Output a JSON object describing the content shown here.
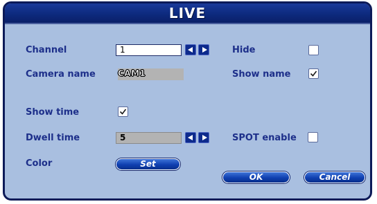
{
  "window": {
    "title": "LIVE"
  },
  "channel": {
    "label": "Channel",
    "value": "1"
  },
  "hide": {
    "label": "Hide",
    "checked": false
  },
  "camera_name": {
    "label": "Camera name",
    "value": "CAM1"
  },
  "show_name": {
    "label": "Show name",
    "checked": true
  },
  "show_time": {
    "label": "Show time",
    "checked": true
  },
  "dwell_time": {
    "label": "Dwell time",
    "value": "5"
  },
  "spot_enable": {
    "label": "SPOT enable",
    "checked": false
  },
  "color": {
    "label": "Color",
    "button_label": "Set"
  },
  "buttons": {
    "ok": "OK",
    "cancel": "Cancel"
  },
  "colors": {
    "panel_bg": "#a9bfe0",
    "title_bar": "#0d2a7e",
    "label_text": "#1d2f8a",
    "button_blue": "#0f3fb0"
  }
}
